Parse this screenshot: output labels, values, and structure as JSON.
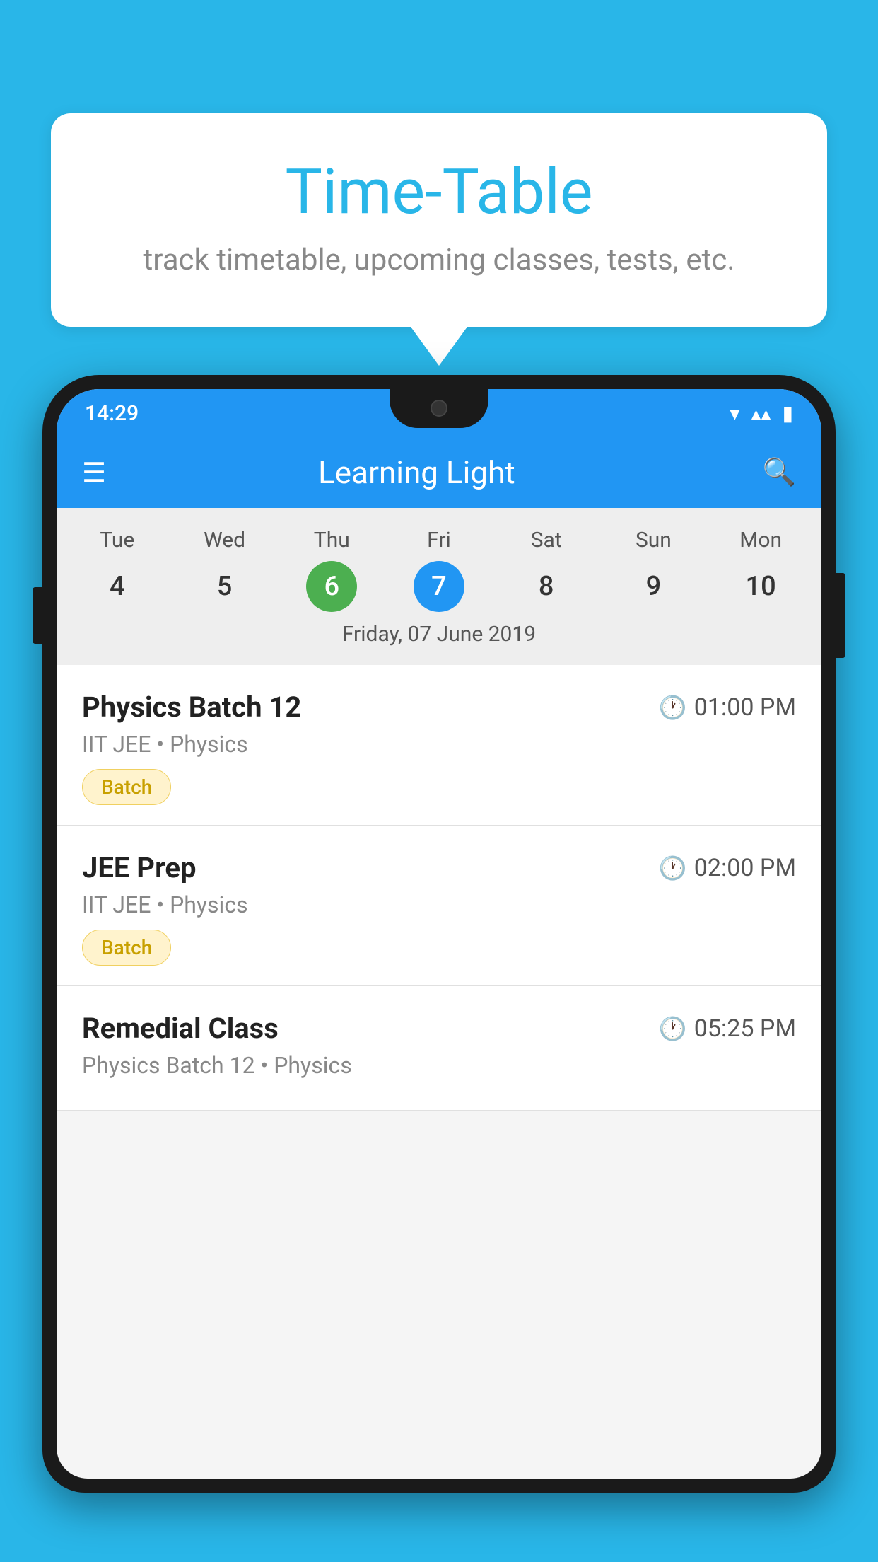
{
  "background_color": "#29b6e8",
  "speech_bubble": {
    "title": "Time-Table",
    "subtitle": "track timetable, upcoming classes, tests, etc."
  },
  "app": {
    "name": "Learning Light",
    "status_bar": {
      "time": "14:29",
      "icons": [
        "wifi",
        "signal",
        "battery"
      ]
    }
  },
  "calendar": {
    "days": [
      {
        "label": "Tue",
        "number": "4"
      },
      {
        "label": "Wed",
        "number": "5"
      },
      {
        "label": "Thu",
        "number": "6",
        "state": "today"
      },
      {
        "label": "Fri",
        "number": "7",
        "state": "selected"
      },
      {
        "label": "Sat",
        "number": "8"
      },
      {
        "label": "Sun",
        "number": "9"
      },
      {
        "label": "Mon",
        "number": "10"
      }
    ],
    "selected_date_label": "Friday, 07 June 2019"
  },
  "schedule": {
    "items": [
      {
        "title": "Physics Batch 12",
        "time": "01:00 PM",
        "subtitle": "IIT JEE • Physics",
        "badge": "Batch"
      },
      {
        "title": "JEE Prep",
        "time": "02:00 PM",
        "subtitle": "IIT JEE • Physics",
        "badge": "Batch"
      },
      {
        "title": "Remedial Class",
        "time": "05:25 PM",
        "subtitle": "Physics Batch 12 • Physics",
        "badge": null
      }
    ]
  },
  "icons": {
    "hamburger": "☰",
    "search": "🔍",
    "clock": "⏱",
    "wifi": "▼",
    "signal": "▲",
    "battery": "▮"
  }
}
